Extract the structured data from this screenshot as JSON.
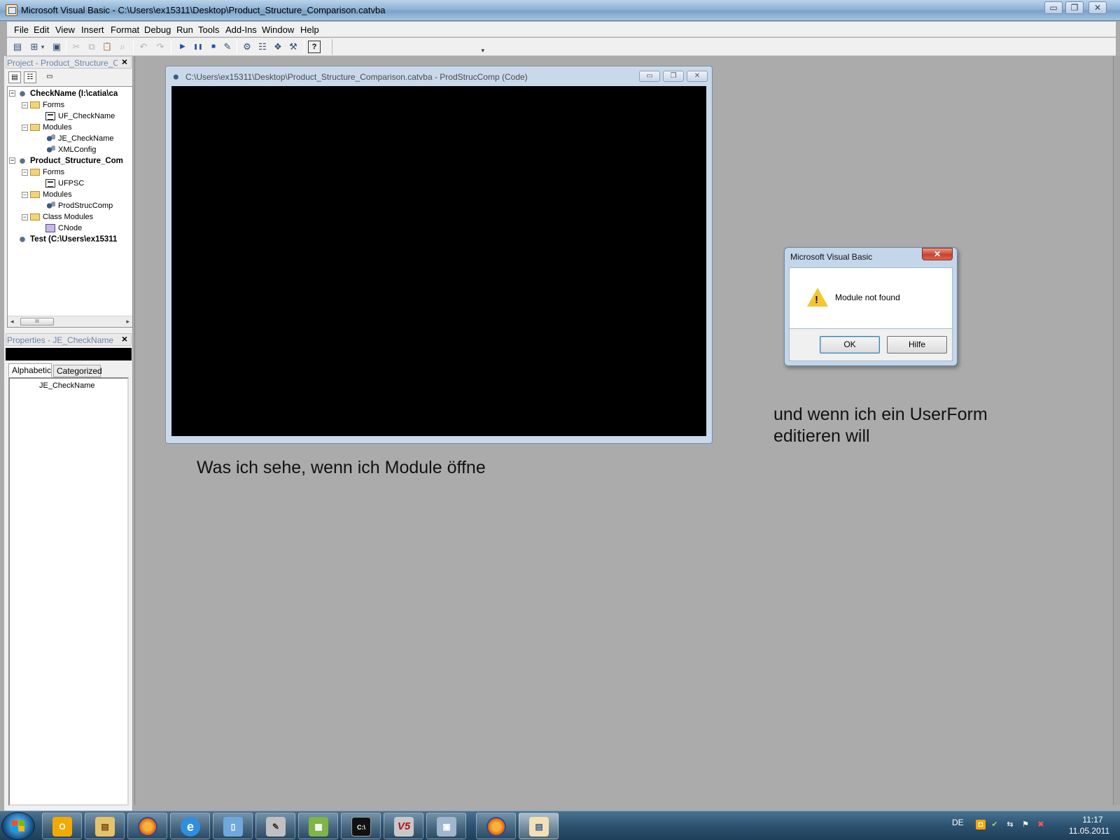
{
  "window": {
    "title": "Microsoft Visual Basic - C:\\Users\\ex15311\\Desktop\\Product_Structure_Comparison.catvba",
    "minimize_icon": "minimize-icon",
    "maximize_icon": "maximize-icon",
    "close_icon": "close-icon",
    "min_glyph": "▭",
    "max_glyph": "❐",
    "close_glyph": "✕"
  },
  "menu": [
    "File",
    "Edit",
    "View",
    "Insert",
    "Format",
    "Debug",
    "Run",
    "Tools",
    "Add-Ins",
    "Window",
    "Help"
  ],
  "toolbar": {
    "icons": [
      {
        "name": "view-object-icon",
        "glyph": "▤",
        "enabled": true
      },
      {
        "name": "insert-module-icon",
        "glyph": "⊞",
        "enabled": true
      },
      {
        "name": "dropdown-arrow-icon",
        "glyph": "▾",
        "enabled": true
      },
      {
        "name": "save-icon",
        "glyph": "▣",
        "enabled": true
      },
      {
        "name": "cut-icon",
        "glyph": "✂",
        "enabled": false
      },
      {
        "name": "copy-icon",
        "glyph": "⧉",
        "enabled": false
      },
      {
        "name": "paste-icon",
        "glyph": "📋",
        "enabled": false
      },
      {
        "name": "find-icon",
        "glyph": "⌕",
        "enabled": false
      },
      {
        "name": "undo-icon",
        "glyph": "↶",
        "enabled": false
      },
      {
        "name": "redo-icon",
        "glyph": "↷",
        "enabled": false
      },
      {
        "name": "run-icon",
        "glyph": "▶",
        "enabled": true
      },
      {
        "name": "break-icon",
        "glyph": "❚❚",
        "enabled": true
      },
      {
        "name": "reset-icon",
        "glyph": "■",
        "enabled": true
      },
      {
        "name": "design-mode-icon",
        "glyph": "✎",
        "enabled": true
      },
      {
        "name": "project-explorer-icon",
        "glyph": "⚙",
        "enabled": true
      },
      {
        "name": "properties-window-icon",
        "glyph": "☷",
        "enabled": true
      },
      {
        "name": "object-browser-icon",
        "glyph": "❖",
        "enabled": true
      },
      {
        "name": "toolbox-icon",
        "glyph": "⚒",
        "enabled": true
      },
      {
        "name": "help-icon",
        "glyph": "?",
        "enabled": true
      }
    ],
    "overflow_glyph": "▾"
  },
  "project_pane": {
    "title": "Project - Product_Structure_Co",
    "close_glyph": "×",
    "tool_glyphs": [
      "▤",
      "☷",
      "▭"
    ],
    "tree": [
      {
        "label": "CheckName (I:\\catia\\ca",
        "type": "project",
        "bold": true,
        "expander": "−"
      },
      {
        "label": "Forms",
        "type": "folder",
        "expander": "−"
      },
      {
        "label": "UF_CheckName",
        "type": "form"
      },
      {
        "label": "Modules",
        "type": "folder",
        "expander": "−"
      },
      {
        "label": "JE_CheckName",
        "type": "module"
      },
      {
        "label": "XMLConfig",
        "type": "module"
      },
      {
        "label": "Product_Structure_Com",
        "type": "project",
        "bold": true,
        "expander": "−"
      },
      {
        "label": "Forms",
        "type": "folder",
        "expander": "−"
      },
      {
        "label": "UFPSC",
        "type": "form"
      },
      {
        "label": "Modules",
        "type": "folder",
        "expander": "−"
      },
      {
        "label": "ProdStrucComp",
        "type": "module"
      },
      {
        "label": "Class Modules",
        "type": "folder",
        "expander": "−"
      },
      {
        "label": "CNode",
        "type": "class"
      },
      {
        "label": "Test (C:\\Users\\ex15311",
        "type": "project",
        "bold": true
      }
    ],
    "scroll": {
      "left": "◂",
      "right": "▸",
      "thumb": "III"
    }
  },
  "properties_pane": {
    "title": "Properties - JE_CheckName",
    "close_glyph": "×",
    "tabs": [
      "Alphabetic",
      "Categorized"
    ],
    "active_tab": 0,
    "name_value": "JE_CheckName"
  },
  "code_window": {
    "title": "C:\\Users\\ex15311\\Desktop\\Product_Structure_Comparison.catvba - ProdStrucComp (Code)",
    "min_glyph": "▭",
    "max_glyph": "❐",
    "close_glyph": "✕"
  },
  "captions": {
    "left": "Was ich sehe, wenn ich Module öffne",
    "right_line1": "und wenn ich ein UserForm",
    "right_line2": "editieren will"
  },
  "message_box": {
    "title": "Microsoft Visual Basic",
    "close_glyph": "✕",
    "icon": "warning-icon",
    "warn_glyph": "!",
    "message": "Module not found",
    "ok_label": "OK",
    "help_label": "Hilfe"
  },
  "taskbar": {
    "apps": [
      {
        "name": "outlook-icon",
        "glyph": "O",
        "color": "#f2a900"
      },
      {
        "name": "explorer-icon",
        "glyph": "▤",
        "color": "#e6c36a"
      },
      {
        "name": "firefox-icon",
        "glyph": "●",
        "color": "#e66000"
      },
      {
        "name": "internet-explorer-icon",
        "glyph": "e",
        "color": "#2f8fdf"
      },
      {
        "name": "notepad-icon",
        "glyph": "▯",
        "color": "#6fa8dc"
      },
      {
        "name": "paint-icon",
        "glyph": "✎",
        "color": "#c0c0c0"
      },
      {
        "name": "editor-icon",
        "glyph": "▦",
        "color": "#7fb446"
      },
      {
        "name": "cmd-icon",
        "glyph": "C:\\",
        "color": "#111111"
      },
      {
        "name": "catia-v5-icon",
        "glyph": "V5",
        "color": "#c8c8c8"
      },
      {
        "name": "window-app-icon",
        "glyph": "▣",
        "color": "#9fb6cc"
      },
      {
        "name": "firefox-icon-2",
        "glyph": "●",
        "color": "#e66000"
      },
      {
        "name": "vba-editor-icon",
        "glyph": "▤",
        "color": "#f3e1b5"
      }
    ],
    "active_index": 11,
    "tray": {
      "language": "DE",
      "icons": [
        {
          "name": "outlook-tray-icon",
          "glyph": "◘"
        },
        {
          "name": "network-icon",
          "glyph": "✔"
        },
        {
          "name": "usb-icon",
          "glyph": "⇆"
        },
        {
          "name": "flag-icon",
          "glyph": "⚑"
        },
        {
          "name": "volume-muted-icon",
          "glyph": "✖"
        }
      ],
      "time": "11:17",
      "date": "11.05.2011"
    }
  }
}
